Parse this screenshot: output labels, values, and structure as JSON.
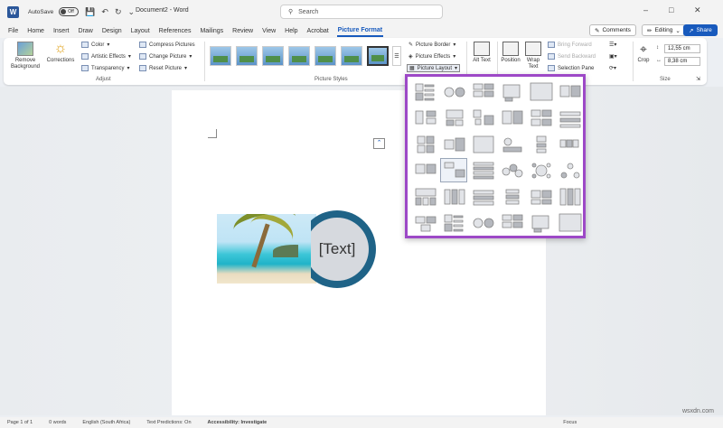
{
  "titlebar": {
    "autosave_label": "AutoSave",
    "autosave_state": "Off",
    "doc_title": "Document2 - Word",
    "search_placeholder": "Search"
  },
  "tabs": [
    "File",
    "Home",
    "Insert",
    "Draw",
    "Design",
    "Layout",
    "References",
    "Mailings",
    "Review",
    "View",
    "Help",
    "Acrobat",
    "Picture Format"
  ],
  "active_tab": "Picture Format",
  "right_buttons": {
    "comments": "Comments",
    "editing": "Editing",
    "share": "Share"
  },
  "ribbon": {
    "adjust": {
      "remove_bg": "Remove Background",
      "corrections": "Corrections",
      "color": "Color",
      "artistic": "Artistic Effects",
      "transparency": "Transparency",
      "compress": "Compress Pictures",
      "change": "Change Picture",
      "reset": "Reset Picture",
      "label": "Adjust"
    },
    "styles": {
      "label": "Picture Styles"
    },
    "picture_cmds": {
      "border": "Picture Border",
      "effects": "Picture Effects",
      "layout": "Picture Layout"
    },
    "accessibility": {
      "alt_text": "Alt Text"
    },
    "arrange": {
      "position": "Position",
      "wrap": "Wrap Text",
      "bring_forward": "Bring Forward",
      "send_backward": "Send Backward",
      "selection_pane": "Selection Pane"
    },
    "size": {
      "crop": "Crop",
      "height": "12,55 cm",
      "width": "8,38 cm",
      "label": "Size"
    }
  },
  "document": {
    "circle_text": "[Text]"
  },
  "status": {
    "page": "Page 1 of 1",
    "words": "0 words",
    "language": "English (South Africa)",
    "predictions": "Text Predictions: On",
    "accessibility": "Accessibility: Investigate",
    "focus": "Focus"
  },
  "watermark": "wsxdn.com",
  "colors": {
    "accent": "#185abd",
    "dropdown_border": "#9d49c7",
    "ring": "#1f6387"
  }
}
